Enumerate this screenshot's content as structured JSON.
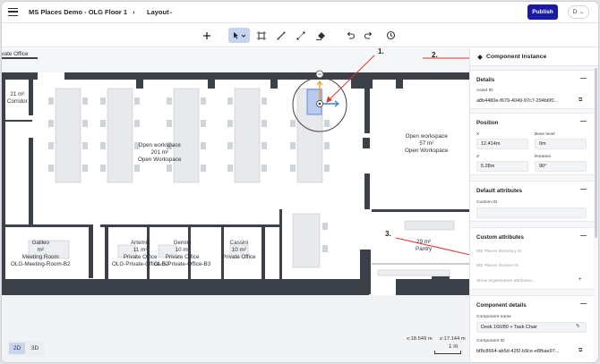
{
  "topbar": {
    "project_title": "MS Places Demo - OLG Floor 1",
    "layout_label": "Layout",
    "publish_label": "Publish",
    "avatar_initial": "D"
  },
  "toolbar": {
    "tools": [
      "add-icon",
      "select-pointer-icon",
      "frame-icon",
      "line-icon",
      "measure-icon",
      "fill-icon",
      "undo-icon",
      "redo-icon",
      "history-icon"
    ]
  },
  "floorplan": {
    "rooms": [
      {
        "id": "private-office-top",
        "lines": [
          "rivate Office"
        ]
      },
      {
        "id": "top-left-partial",
        "lines": [
          "m²"
        ]
      },
      {
        "id": "corridor",
        "lines": [
          "21 m²",
          "Corridor"
        ]
      },
      {
        "id": "open-workspace-left",
        "lines": [
          "Open workspace",
          "201 m²",
          "Open Workspace"
        ]
      },
      {
        "id": "open-workspace-right",
        "lines": [
          "Open workspace",
          "57 m²",
          "Open Workspace"
        ]
      },
      {
        "id": "galileo",
        "lines": [
          "Galileo",
          "m²",
          "Meeting Room",
          "OLG-Meeting-Room-B2"
        ]
      },
      {
        "id": "artemis",
        "lines": [
          "Artemis",
          "11 m²",
          "Private Office",
          "OLG-Private-Office-B2"
        ]
      },
      {
        "id": "gemini",
        "lines": [
          "Gemini",
          "10 m²",
          "Private Office",
          "OLG-Private-Office-B3"
        ]
      },
      {
        "id": "cassini",
        "lines": [
          "Cassini",
          "10 m²",
          "Private Office"
        ]
      },
      {
        "id": "pantry",
        "lines": [
          "29 m²",
          "Pantry"
        ]
      }
    ],
    "view_2d": "2D",
    "view_3d": "3D",
    "coord_x": "x:18.549 m",
    "coord_z": "z:17.144 m",
    "scale_label": "1 m"
  },
  "annotations": {
    "a1": "1.",
    "a2": "2.",
    "a3": "3."
  },
  "panel": {
    "title": "Component Instance",
    "details": {
      "title": "Details",
      "asset_id_label": "Asset ID",
      "asset_id_value": "a8b4480e-f679-4049-97c7-294b6f0..."
    },
    "position": {
      "title": "Position",
      "x_label": "X",
      "x_value": "12.414m",
      "base_label": "Base level",
      "base_value": "0m",
      "z_label": "Z",
      "z_value": "5.28m",
      "rotation_label": "Rotation",
      "rotation_value": "90°"
    },
    "default_attrs": {
      "title": "Default attributes",
      "custom_id_label": "Custom ID",
      "custom_id_value": ""
    },
    "custom_attrs": {
      "title": "Custom attributes",
      "directory_label": "MS Places Directory Id",
      "section_label": "MS Places Section Id",
      "show_org": "Show organization attributes..."
    },
    "component_details": {
      "title": "Component details",
      "name_label": "Component name",
      "name_value": "Desk 160/80 + Task Chair",
      "id_label": "Component ID",
      "id_value": "bf8c8664-ab5d-42f2-b9ce-e8fbae97..."
    }
  },
  "colors": {
    "wall": "#3c4149",
    "desk": "#e7e9ec",
    "selection": "#b9cbee",
    "publish": "#1a1aa6",
    "annotation_arrow": "#e0342f"
  }
}
